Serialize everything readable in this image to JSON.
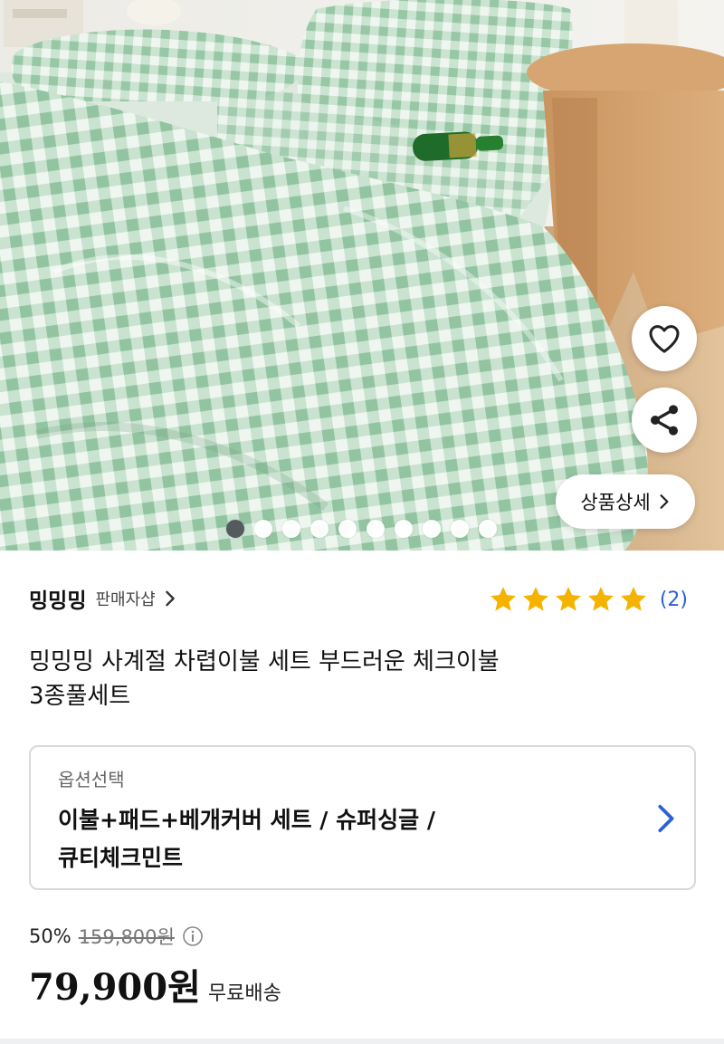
{
  "product_image": {
    "alt": "",
    "carousel": {
      "total": 10,
      "active_index": 0
    },
    "detail_button_label": "상품상세",
    "icons": {
      "wishlist": "heart-icon",
      "share": "share-icon",
      "detail": "chevron-right-icon"
    }
  },
  "seller": {
    "name": "밍밍밍",
    "shop_link": "판매자샵"
  },
  "rating": {
    "stars": 5,
    "review_count": "(2)",
    "star_color": "#f5b301"
  },
  "product": {
    "title_line1": "밍밍밍 사계절 차렵이불 세트 부드러운 체크이불",
    "title_line2": "3종풀세트"
  },
  "option": {
    "label": "옵션선택",
    "value_line1": "이불+패드+베개커버 세트 / 슈퍼싱글 /",
    "value_line2": "큐티체크민트"
  },
  "price": {
    "discount_rate": "50%",
    "original_price": "159,800원",
    "sale_price": "79,900원",
    "shipping": "무료배송"
  },
  "colors": {
    "accent_blue": "#2a60d8",
    "mint": "#a8cfb4"
  }
}
